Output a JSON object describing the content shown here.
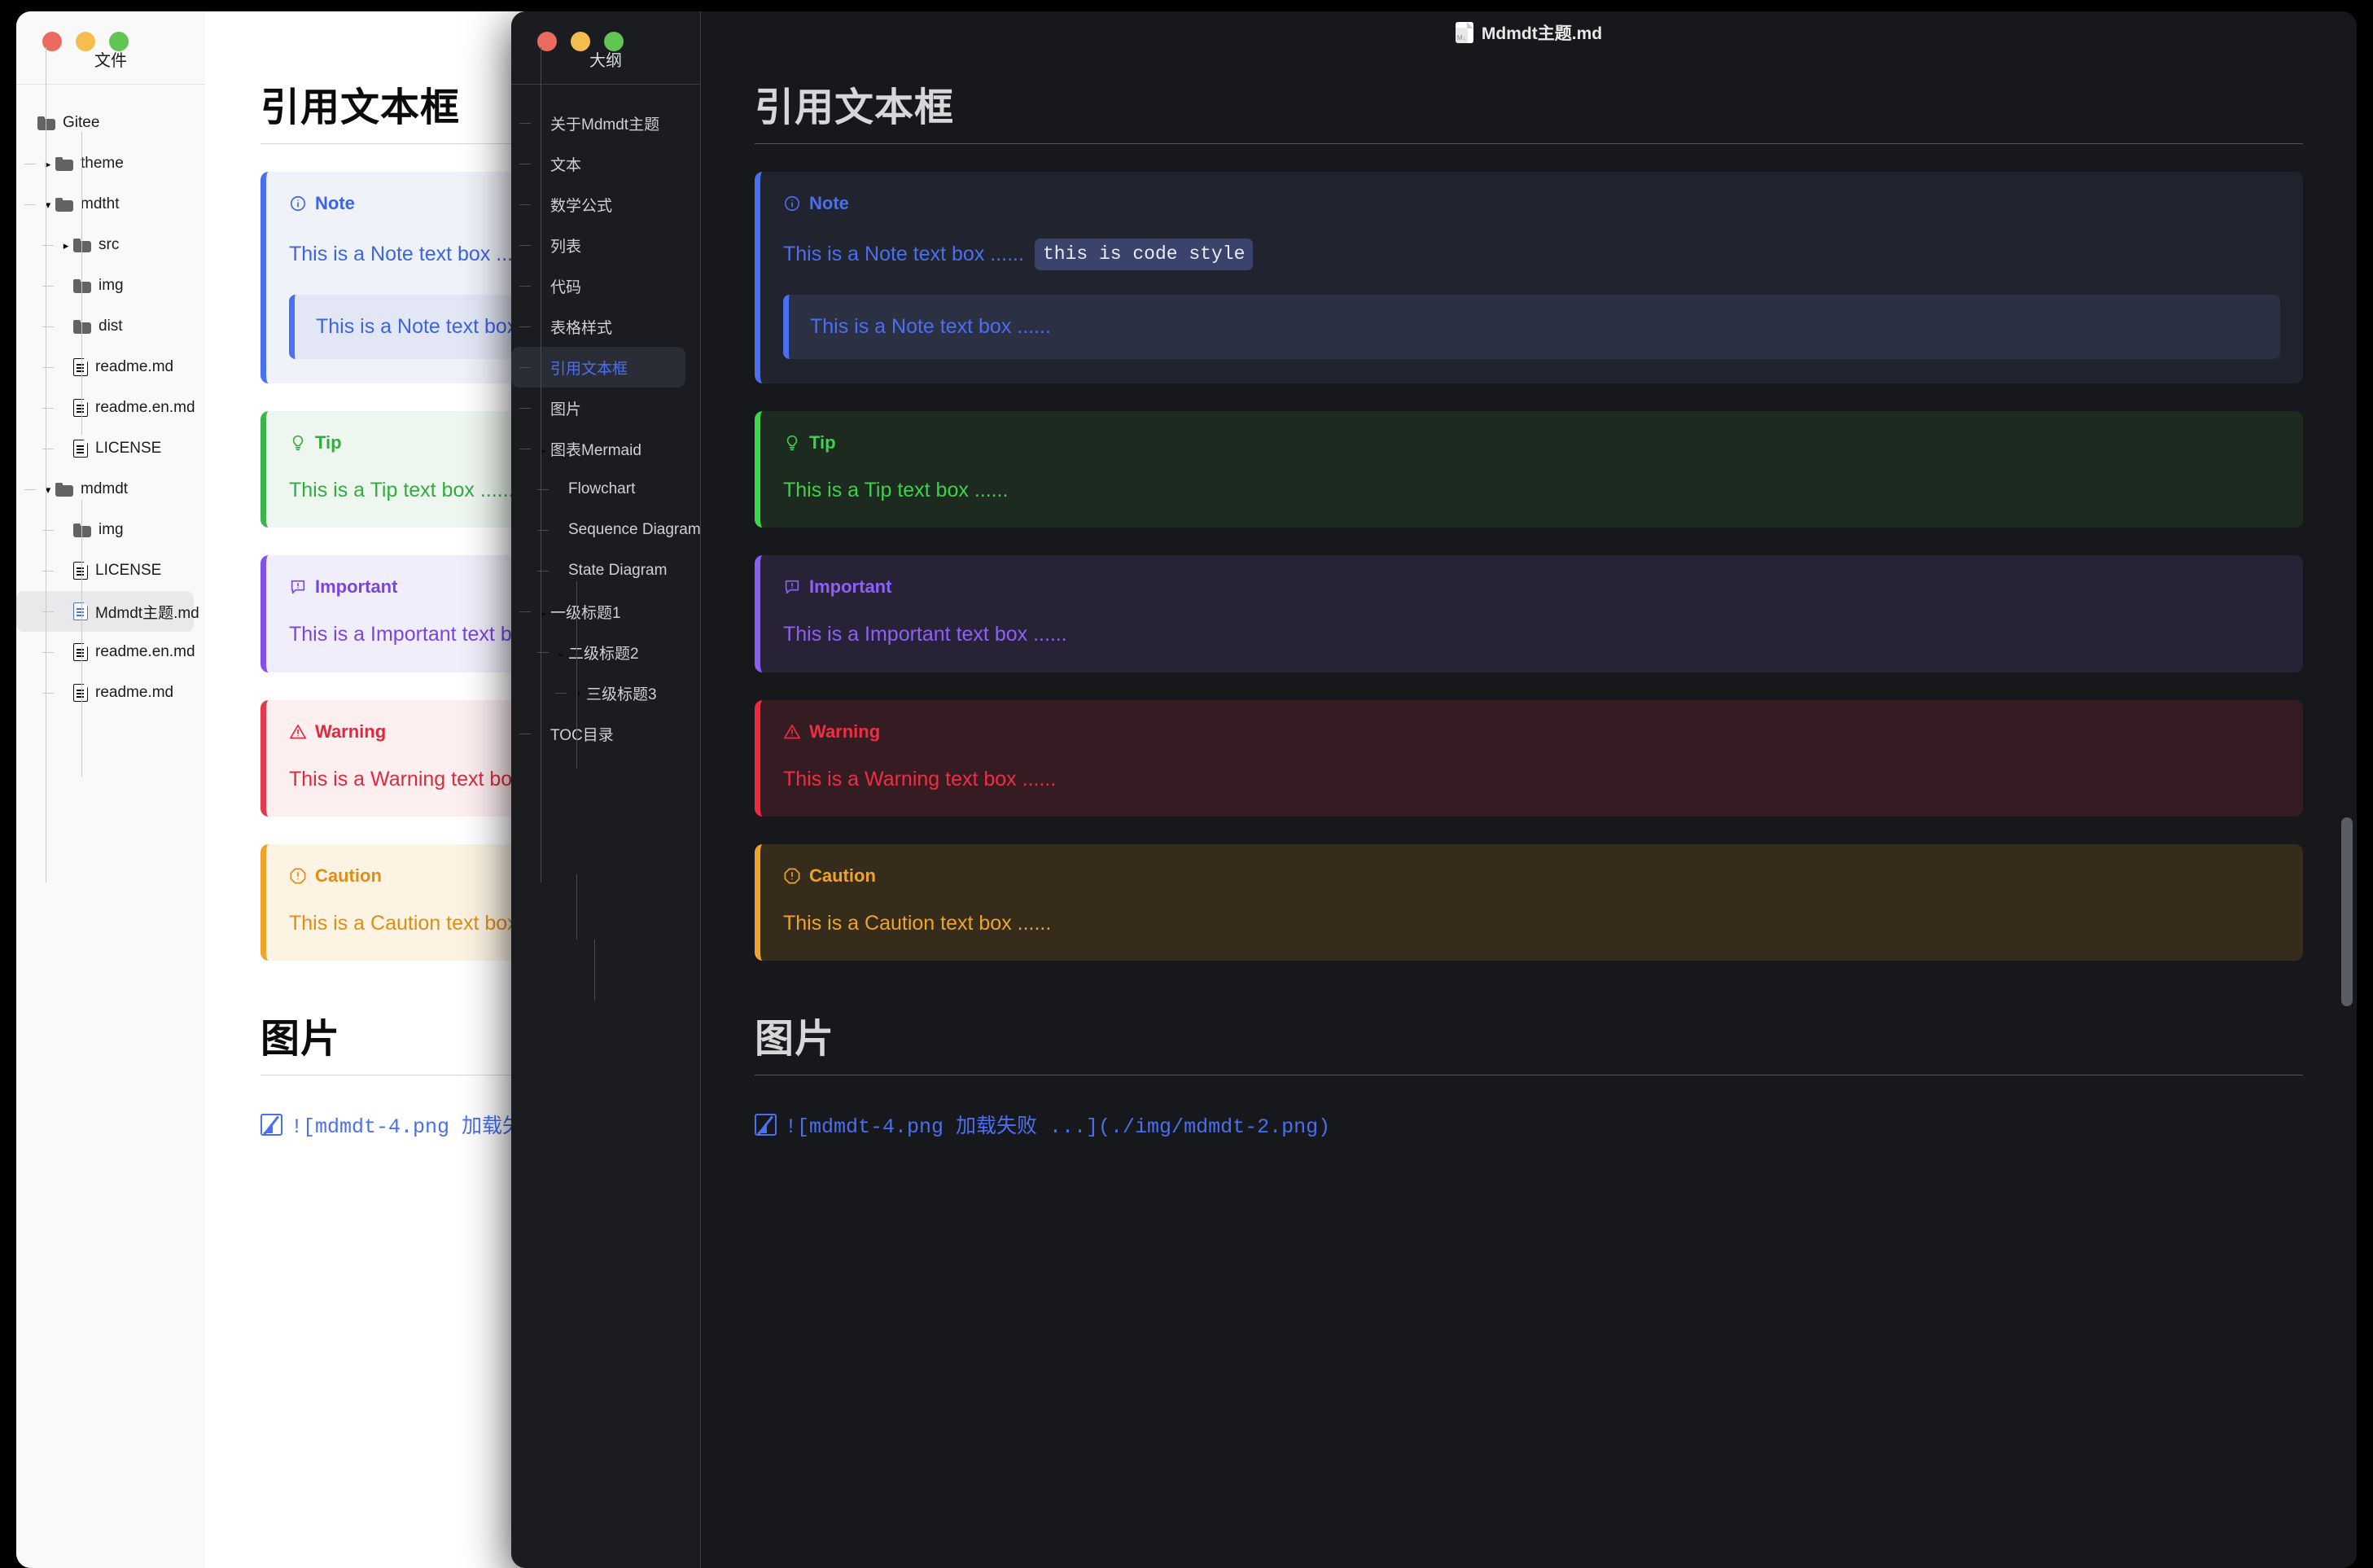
{
  "light_window": {
    "sidebar": {
      "panel_title": "文件",
      "tree": [
        {
          "label": "Gitee",
          "type": "folder",
          "depth": 0,
          "twisty": ""
        },
        {
          "label": "theme",
          "type": "folder",
          "depth": 1,
          "twisty": "▸"
        },
        {
          "label": "mdtht",
          "type": "folder",
          "depth": 1,
          "twisty": "▾"
        },
        {
          "label": "src",
          "type": "folder",
          "depth": 2,
          "twisty": "▸"
        },
        {
          "label": "img",
          "type": "folder",
          "depth": 2,
          "twisty": ""
        },
        {
          "label": "dist",
          "type": "folder",
          "depth": 2,
          "twisty": ""
        },
        {
          "label": "readme.md",
          "type": "file",
          "depth": 2,
          "twisty": ""
        },
        {
          "label": "readme.en.md",
          "type": "file",
          "depth": 2,
          "twisty": ""
        },
        {
          "label": "LICENSE",
          "type": "file",
          "depth": 2,
          "twisty": ""
        },
        {
          "label": "mdmdt",
          "type": "folder",
          "depth": 1,
          "twisty": "▾"
        },
        {
          "label": "img",
          "type": "folder",
          "depth": 2,
          "twisty": ""
        },
        {
          "label": "LICENSE",
          "type": "file",
          "depth": 2,
          "twisty": ""
        },
        {
          "label": "Mdmdt主题.md",
          "type": "file",
          "depth": 2,
          "twisty": "",
          "selected": true
        },
        {
          "label": "readme.en.md",
          "type": "file",
          "depth": 2,
          "twisty": ""
        },
        {
          "label": "readme.md",
          "type": "file",
          "depth": 2,
          "twisty": ""
        }
      ]
    },
    "document": {
      "titlebar_filename": "Mdmdt主题.md",
      "heading": "引用文本框",
      "heading2": "图片",
      "image_line": "![mdmdt-4.png 加载失败 ...](./img/mdmdt-2.png)"
    }
  },
  "dark_window": {
    "outline": {
      "panel_title": "大纲",
      "items": [
        {
          "label": "关于Mdmdt主题",
          "depth": 1,
          "twisty": ""
        },
        {
          "label": "文本",
          "depth": 1,
          "twisty": ""
        },
        {
          "label": "数学公式",
          "depth": 1,
          "twisty": ""
        },
        {
          "label": "列表",
          "depth": 1,
          "twisty": ""
        },
        {
          "label": "代码",
          "depth": 1,
          "twisty": ""
        },
        {
          "label": "表格样式",
          "depth": 1,
          "twisty": ""
        },
        {
          "label": "引用文本框",
          "depth": 1,
          "twisty": "",
          "selected": true
        },
        {
          "label": "图片",
          "depth": 1,
          "twisty": ""
        },
        {
          "label": "图表Mermaid",
          "depth": 1,
          "twisty": "⌄"
        },
        {
          "label": "Flowchart",
          "depth": 2,
          "twisty": ""
        },
        {
          "label": "Sequence Diagram",
          "depth": 2,
          "twisty": ""
        },
        {
          "label": "State Diagram",
          "depth": 2,
          "twisty": ""
        },
        {
          "label": "一级标题1",
          "depth": 1,
          "twisty": "⌄"
        },
        {
          "label": "二级标题2",
          "depth": 2,
          "twisty": "⌄"
        },
        {
          "label": "三级标题3",
          "depth": 3,
          "twisty": "›"
        },
        {
          "label": "TOC目录",
          "depth": 1,
          "twisty": ""
        }
      ]
    },
    "document": {
      "titlebar_filename": "Mdmdt主题.md",
      "heading": "引用文本框",
      "heading2": "图片",
      "image_line": "![mdmdt-4.png 加载失败 ...](./img/mdmdt-2.png)"
    }
  },
  "callouts": [
    {
      "key": "note",
      "title": "Note",
      "icon": "info-circle-icon",
      "body": "This is a Note text box ......",
      "code": "this is code style",
      "nested_body": "This is a Note text box ......",
      "light": {
        "bg": "#f0f2fa",
        "bar": "#4a6ff0",
        "fg": "#3b64e8",
        "code_bg": "#dfe4f7",
        "nested_bg": "#e3e7f5"
      },
      "dark": {
        "bg": "#21242e",
        "bar": "#4a6ff0",
        "fg": "#4a6ff0",
        "code_bg": "#39436b",
        "code_fg": "#e8eaf4",
        "nested_bg": "#2b3043"
      }
    },
    {
      "key": "tip",
      "title": "Tip",
      "icon": "lightbulb-icon",
      "body": "This is a Tip text box ......",
      "light": {
        "bg": "#eef7ef",
        "bar": "#3bb54a",
        "fg": "#2fae3e"
      },
      "dark": {
        "bg": "#1d2a1f",
        "bar": "#3bd94a",
        "fg": "#3cd34a"
      }
    },
    {
      "key": "important",
      "title": "Important",
      "icon": "comment-alert-icon",
      "body": "This is a Important text box ......",
      "light": {
        "bg": "#f1eefb",
        "bar": "#8350e8",
        "fg": "#7a44e0"
      },
      "dark": {
        "bg": "#272235",
        "bar": "#8c5cf6",
        "fg": "#8f60f7"
      }
    },
    {
      "key": "warning",
      "title": "Warning",
      "icon": "triangle-alert-icon",
      "body": "This is a Warning text box ......",
      "light": {
        "bg": "#fdeef0",
        "bar": "#e5384a",
        "fg": "#e0293c"
      },
      "dark": {
        "bg": "#351c22",
        "bar": "#f0293f",
        "fg": "#ef2e43"
      }
    },
    {
      "key": "caution",
      "title": "Caution",
      "icon": "octagon-alert-icon",
      "body": "This is a Caution text box ......",
      "light": {
        "bg": "#fdf3e3",
        "bar": "#f0a32a",
        "fg": "#e08d15"
      },
      "dark": {
        "bg": "#352c1c",
        "bar": "#f0a32a",
        "fg": "#f0a32a"
      }
    }
  ]
}
